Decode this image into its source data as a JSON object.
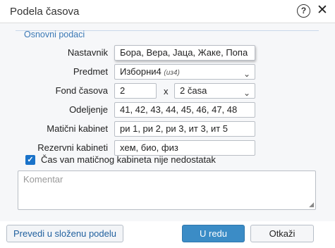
{
  "dialog": {
    "title": "Podela časova"
  },
  "section": {
    "label": "Osnovni podaci"
  },
  "form": {
    "nastavnik": {
      "label": "Nastavnik",
      "value": "Бора, Вера, Јаца, Жаке, Попа"
    },
    "predmet": {
      "label": "Predmet",
      "value": "Изборни4",
      "hint": "(из4)"
    },
    "fond": {
      "label": "Fond časova",
      "value": "2",
      "times": "x",
      "per": "2 časa"
    },
    "odeljenje": {
      "label": "Odeljenje",
      "value": "41, 42, 43, 44, 45, 46, 47, 48"
    },
    "maticni": {
      "label": "Matični kabinet",
      "value": "ри 1, ри 2, ри 3, ит 3, ит 5"
    },
    "rezervni": {
      "label": "Rezervni kabineti",
      "value": "хем, био, физ"
    }
  },
  "checkbox": {
    "label": "Čas van matičnog kabineta nije nedostatak",
    "checked": true
  },
  "comment": {
    "placeholder": "Komentar"
  },
  "buttons": {
    "prevedi": "Prevedi u složenu podelu",
    "ok": "U redu",
    "cancel": "Otkaži"
  }
}
